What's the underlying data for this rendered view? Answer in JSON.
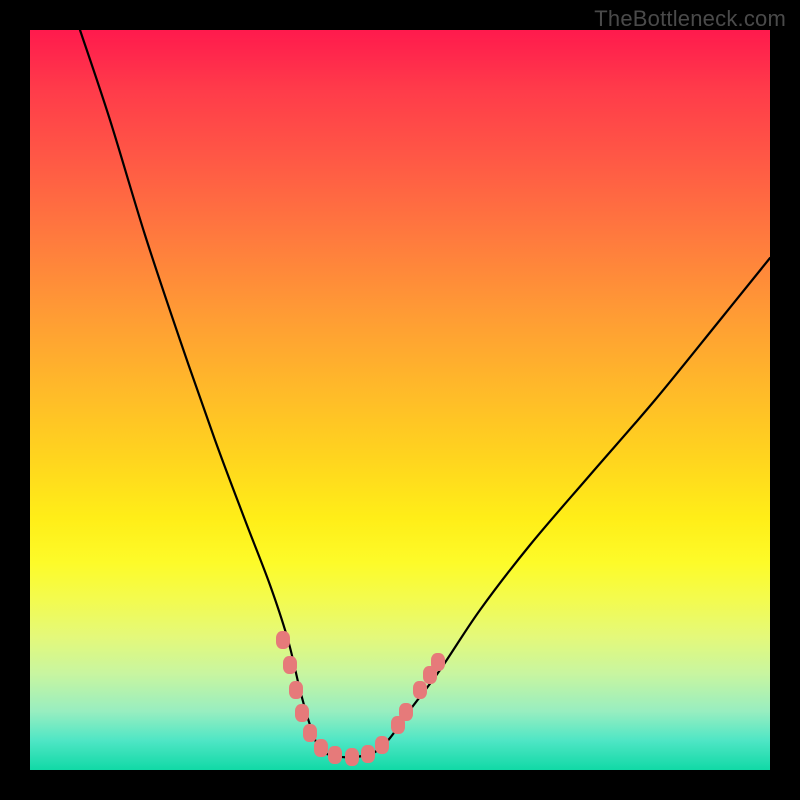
{
  "watermark": "TheBottleneck.com",
  "colors": {
    "bg_black": "#000000",
    "gradient_top": "#ff1a4d",
    "gradient_bottom": "#11d9a6",
    "curve_stroke": "#000000",
    "marker_fill": "#e67a7a"
  },
  "chart_data": {
    "type": "line",
    "title": "",
    "xlabel": "",
    "ylabel": "",
    "xlim": [
      30,
      770
    ],
    "ylim": [
      30,
      770
    ],
    "note": "Axes are unlabeled in the source image; values below are pixel-space coordinates (y increases downward). The figure shows a decorative V-shaped bottleneck curve over a red-to-green vertical gradient with light-red rounded markers clustered near the bottom of the valley.",
    "series": [
      {
        "name": "bottleneck-curve",
        "x": [
          80,
          110,
          145,
          180,
          215,
          245,
          270,
          288,
          300,
          310,
          320,
          335,
          355,
          375,
          390,
          410,
          440,
          480,
          530,
          590,
          655,
          720,
          770
        ],
        "y": [
          30,
          120,
          235,
          340,
          440,
          520,
          585,
          640,
          690,
          725,
          749,
          756,
          757,
          752,
          738,
          710,
          670,
          610,
          545,
          475,
          400,
          320,
          258
        ]
      }
    ],
    "markers": {
      "name": "valley-markers",
      "points": [
        {
          "x": 283,
          "y": 640
        },
        {
          "x": 290,
          "y": 665
        },
        {
          "x": 296,
          "y": 690
        },
        {
          "x": 302,
          "y": 713
        },
        {
          "x": 310,
          "y": 733
        },
        {
          "x": 321,
          "y": 748
        },
        {
          "x": 335,
          "y": 755
        },
        {
          "x": 352,
          "y": 757
        },
        {
          "x": 368,
          "y": 754
        },
        {
          "x": 382,
          "y": 745
        },
        {
          "x": 398,
          "y": 725
        },
        {
          "x": 406,
          "y": 712
        },
        {
          "x": 420,
          "y": 690
        },
        {
          "x": 430,
          "y": 675
        },
        {
          "x": 438,
          "y": 662
        }
      ]
    }
  }
}
